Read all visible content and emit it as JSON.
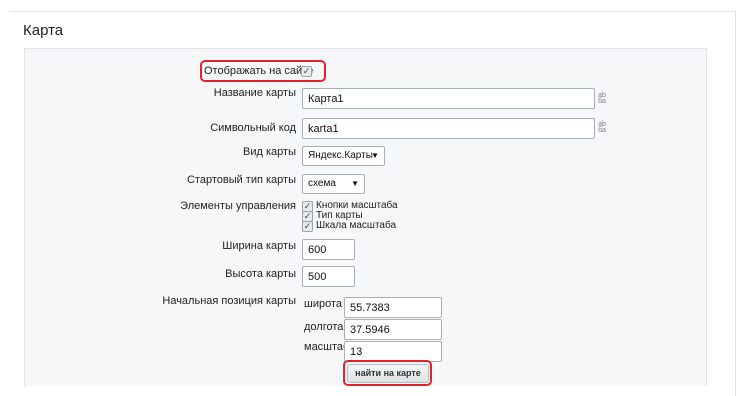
{
  "page_title": "Карта",
  "show_on_site": {
    "label": "Отображать на сайте",
    "checked": true
  },
  "fields": {
    "map_name": {
      "label": "Название карты",
      "value": "Карта1"
    },
    "symbolic_code": {
      "label": "Символьный код",
      "value": "karta1"
    },
    "map_type": {
      "label": "Вид карты",
      "value": "Яндекс.Карты"
    },
    "start_type": {
      "label": "Стартовый тип карты",
      "value": "схема"
    },
    "controls": {
      "label": "Элементы управления",
      "items": [
        {
          "label": "Кнопки масштаба",
          "checked": true
        },
        {
          "label": "Тип карты",
          "checked": true
        },
        {
          "label": "Шкала масштаба",
          "checked": true
        }
      ]
    },
    "width": {
      "label": "Ширина карты",
      "value": "600"
    },
    "height": {
      "label": "Высота карты",
      "value": "500"
    },
    "start_position": {
      "label": "Начальная позиция карты",
      "latitude": {
        "label": "широта",
        "value": "55.7383"
      },
      "longitude": {
        "label": "долгота",
        "value": "37.5946"
      },
      "scale": {
        "label": "масштаб",
        "value": "13"
      }
    }
  },
  "find_button": "найти на карте",
  "colors": {
    "highlight": "#e0222b",
    "panel": "#f5f7f8",
    "input_border": "#a7b0b4"
  }
}
